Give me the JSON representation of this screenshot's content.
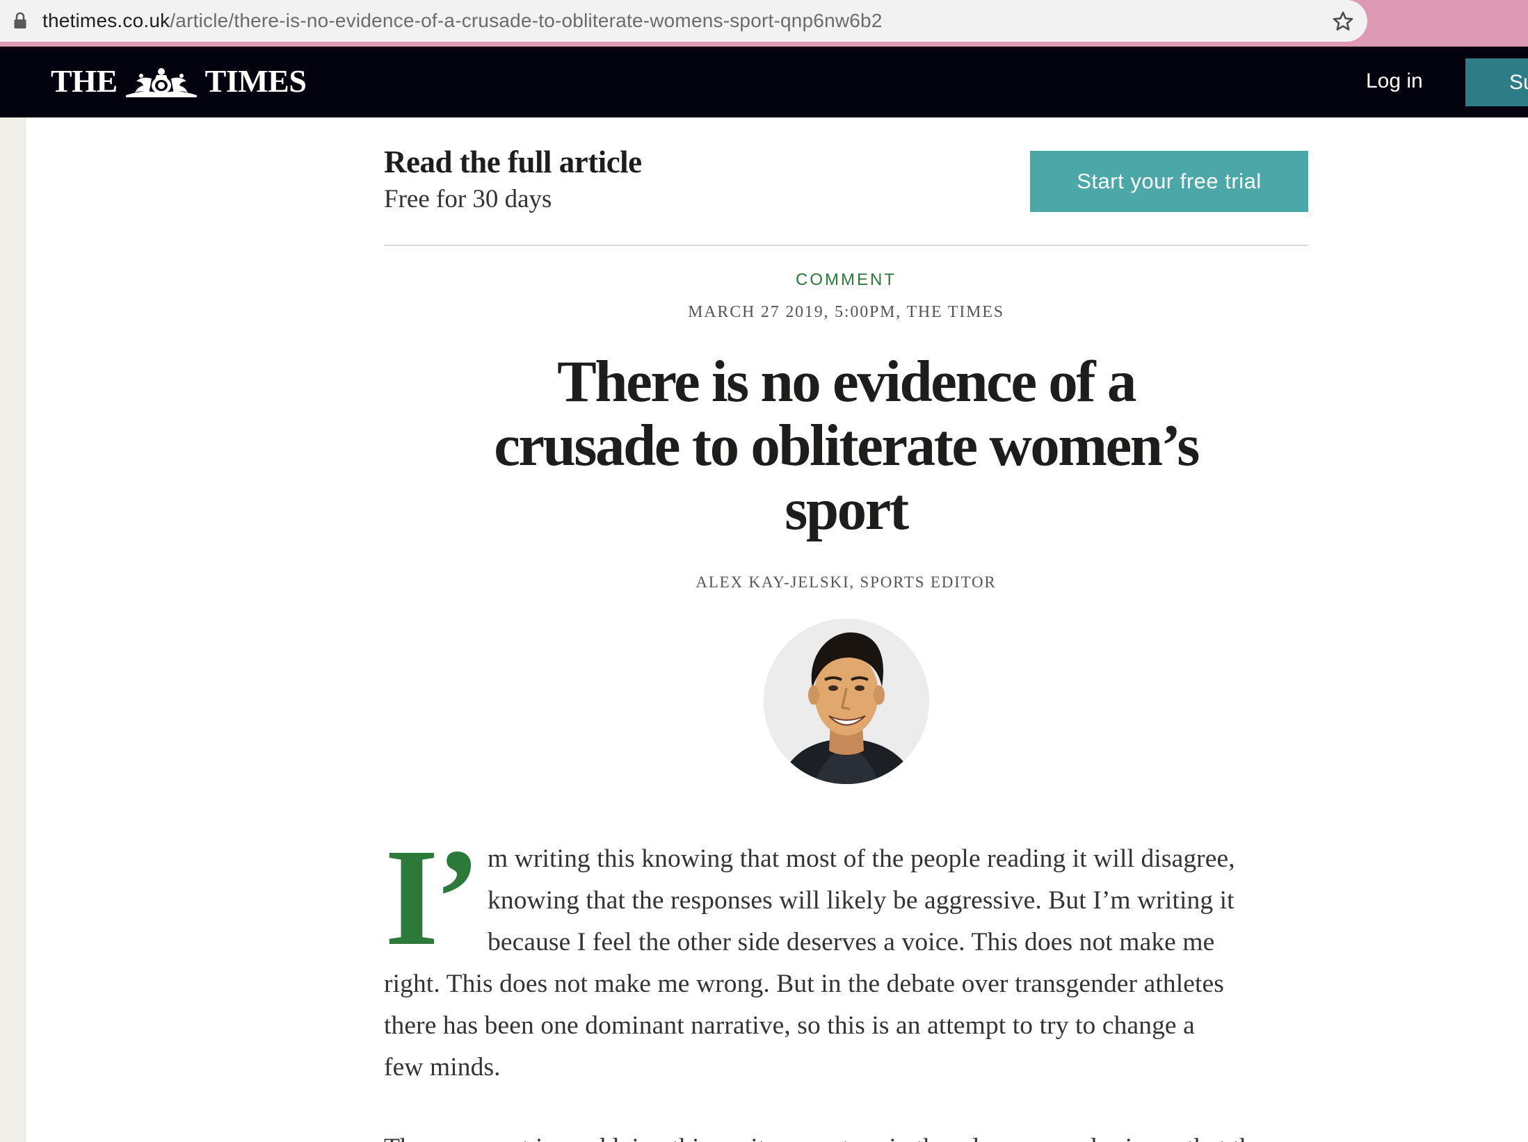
{
  "browser": {
    "url_host": "thetimes.co.uk",
    "url_path": "/article/there-is-no-evidence-of-a-crusade-to-obliterate-womens-sport-qnp6nw6b2",
    "secure_icon": "lock-icon",
    "bookmark_icon": "star-icon",
    "bar_color": "#dd98b4"
  },
  "header": {
    "logo_left": "THE",
    "logo_right": "TIMES",
    "login_label": "Log in",
    "subscribe_label": "Su",
    "background": "#03030f",
    "subscribe_color": "#2c7d86"
  },
  "paywall": {
    "title": "Read the full article",
    "subtitle": "Free for 30 days",
    "trial_button": "Start your free trial",
    "button_color": "#4ba7a8"
  },
  "article": {
    "section": "COMMENT",
    "dateline": "MARCH 27 2019, 5:00PM, THE TIMES",
    "headline_lines": [
      "There is no evidence of a",
      "crusade to obliterate women’s",
      "sport"
    ],
    "byline": "ALEX KAY-JELSKI, SPORTS EDITOR",
    "author_photo_icon": "author-avatar",
    "drop_cap": "I’",
    "body_lines": [
      "m writing this knowing that most of the people reading it will disagree,",
      "knowing that the responses will likely be aggressive. But I’m writing it",
      "because I feel the other side deserves a voice. This does not make me",
      "right. This does not make me wrong. But in the debate over transgender athletes",
      "there has been one dominant narrative, so this is an attempt to try to change a",
      "few minds."
    ],
    "cut_off_line": "The argument is muddying this, as it seems to mix the advocacy and science that the",
    "accent_color": "#2b7a3a"
  }
}
